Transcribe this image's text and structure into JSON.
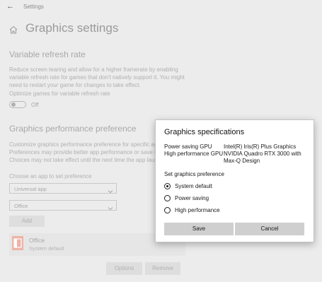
{
  "window": {
    "title": "Settings"
  },
  "page": {
    "title": "Graphics settings"
  },
  "vrr": {
    "title": "Variable refresh rate",
    "description_lines": [
      "Reduce screen tearing and allow for a higher framerate by enabling",
      "variable refresh rate for games that don't natively support it. You might",
      "need to restart your game for changes to take effect."
    ],
    "toggle_label": "Optimize games for variable refresh rate",
    "toggle_state": "Off"
  },
  "gpp": {
    "title": "Graphics performance preference",
    "description_lines": [
      "Customize graphics performance preference for specific app",
      "Preferences may provide better app performance or save ba",
      "Choices may not take effect until the next time the app launc"
    ],
    "choose_label": "Choose an app to set preference",
    "app_type_value": "Universal app",
    "app_value": "Office",
    "add_label": "Add"
  },
  "app_entry": {
    "name": "Office",
    "status": "System default",
    "options_label": "Options",
    "remove_label": "Remove"
  },
  "dialog": {
    "title": "Graphics specifications",
    "power_saving_label": "Power saving GPU",
    "power_saving_value": "Intel(R) Iris(R) Plus Graphics",
    "high_perf_label": "High performance GPU",
    "high_perf_value_lines": [
      "NVIDIA Quadro RTX 3000 with",
      "Max-Q Design"
    ],
    "set_pref_label": "Set graphics preference",
    "options": [
      "System default",
      "Power saving",
      "High performance"
    ],
    "selected_option": "System default",
    "save_label": "Save",
    "cancel_label": "Cancel"
  }
}
